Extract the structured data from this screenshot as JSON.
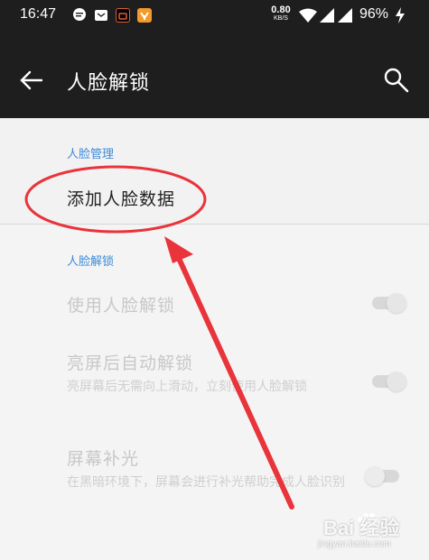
{
  "status_bar": {
    "time": "16:47",
    "net_speed": "0.80",
    "net_unit": "KB/S",
    "battery": "96%"
  },
  "app_bar": {
    "title": "人脸解锁"
  },
  "sections": {
    "face_management": {
      "header": "人脸管理",
      "add_item": "添加人脸数据"
    },
    "face_unlock": {
      "header": "人脸解锁",
      "items": [
        {
          "title": "使用人脸解锁",
          "subtitle": "",
          "enabled": true
        },
        {
          "title": "亮屏后自动解锁",
          "subtitle": "亮屏幕后无需向上滑动，立刻使用人脸解锁",
          "enabled": true
        },
        {
          "title": "屏幕补光",
          "subtitle": "在黑暗环境下，屏幕会进行补光帮助完成人脸识别",
          "enabled": false
        }
      ]
    }
  },
  "colors": {
    "accent": "#3d8bd9",
    "annotation_red": "#e8343a",
    "appbar_bg": "#1e1e1e"
  },
  "watermark": {
    "brand": "Bai 经验",
    "url": "jingyan.baidu.com"
  }
}
